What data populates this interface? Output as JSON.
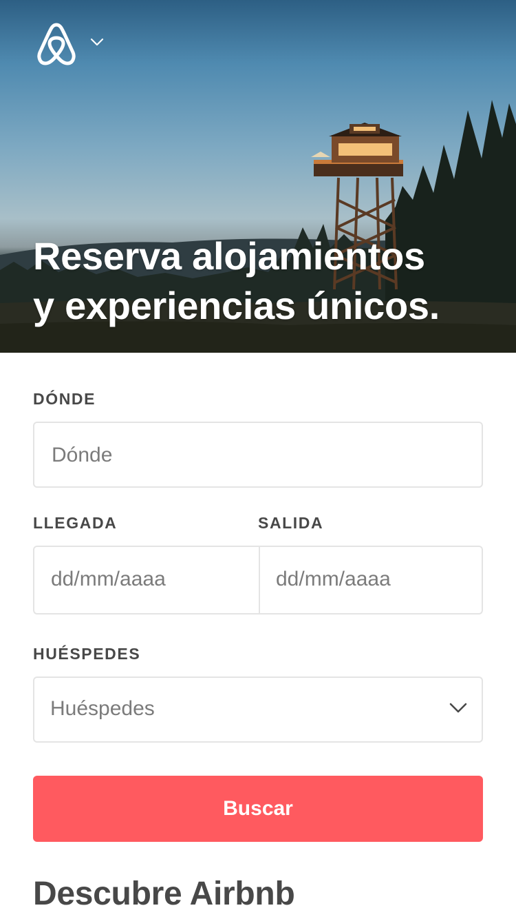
{
  "hero": {
    "headline_line1": "Reserva alojamientos",
    "headline_line2": "y experiencias únicos."
  },
  "brand": {
    "logo_icon": "airbnb-belo-icon",
    "menu_icon": "chevron-down-icon"
  },
  "search": {
    "where_label": "DÓNDE",
    "where_placeholder": "Dónde",
    "checkin_label": "LLEGADA",
    "checkin_placeholder": "dd/mm/aaaa",
    "checkout_label": "SALIDA",
    "checkout_placeholder": "dd/mm/aaaa",
    "guests_label": "HUÉSPEDES",
    "guests_placeholder": "Huéspedes",
    "guests_icon": "chevron-down-icon",
    "button_label": "Buscar"
  },
  "discover": {
    "title": "Descubre Airbnb"
  },
  "colors": {
    "accent": "#FF5A5F",
    "text": "#484848",
    "placeholder": "#7B7B7B",
    "border": "#E4E4E4"
  }
}
